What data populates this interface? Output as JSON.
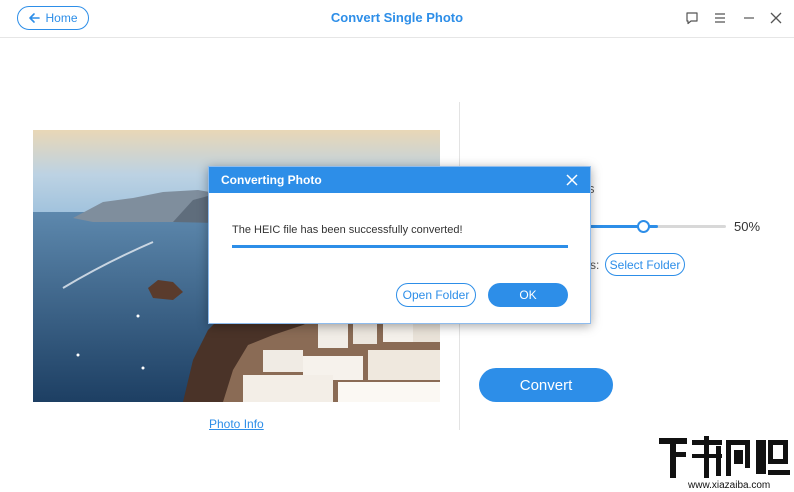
{
  "window": {
    "title": "Convert Single Photo",
    "home_label": "Home",
    "icons": [
      "arrow-left-icon",
      "feedback-icon",
      "menu-icon",
      "minimize-icon",
      "close-icon"
    ]
  },
  "left_panel": {
    "photo_info_link": "Photo Info"
  },
  "right_panel": {
    "partial_text_top": "s",
    "quality_value": "50%",
    "quality_fraction": 0.5,
    "partial_text_colon": "s:",
    "select_folder_label": "Select Folder",
    "convert_label": "Convert"
  },
  "dialog": {
    "title": "Converting Photo",
    "message": "The HEIC file has been successfully converted!",
    "progress_fraction": 1.0,
    "open_folder_label": "Open Folder",
    "ok_label": "OK"
  },
  "colors": {
    "accent": "#2d8ee8",
    "background": "#ffffff"
  }
}
